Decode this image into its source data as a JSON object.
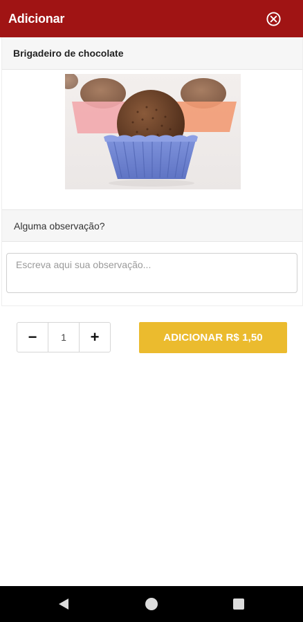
{
  "header": {
    "title": "Adicionar",
    "close_icon": "close-circle-icon",
    "background": "#a01414"
  },
  "product": {
    "name": "Brigadeiro de chocolate",
    "image_subject": "brigadeiro in blue paper cup"
  },
  "observation": {
    "label": "Alguma observação?",
    "placeholder": "Escreva aqui sua observação...",
    "value": ""
  },
  "quantity": {
    "minus_label": "−",
    "value": "1",
    "plus_label": "+"
  },
  "add_button": {
    "label": "ADICIONAR R$ 1,50",
    "color": "#ebbb2e"
  },
  "navbar": {
    "back_icon": "back-triangle-icon",
    "home_icon": "home-circle-icon",
    "recents_icon": "recents-square-icon"
  }
}
